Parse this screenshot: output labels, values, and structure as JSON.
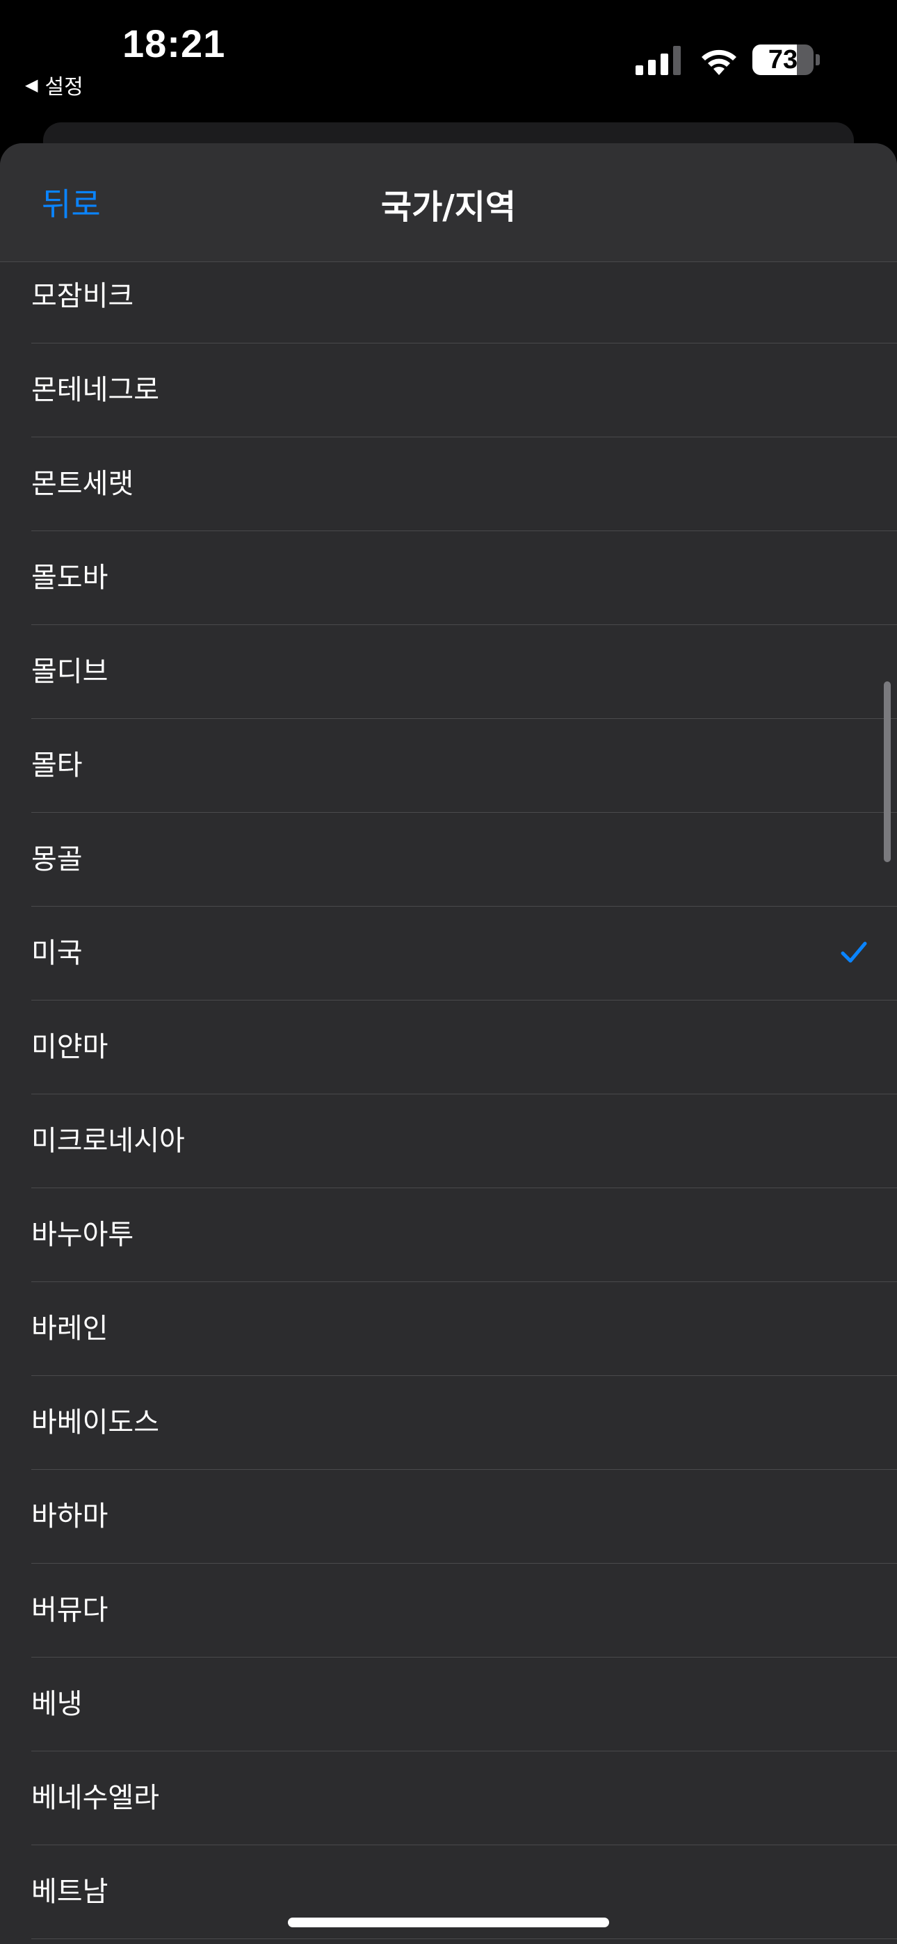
{
  "status": {
    "time": "18:21",
    "back_app_label": "설정",
    "battery_level": "73"
  },
  "nav": {
    "back_label": "뒤로",
    "title": "국가/지역"
  },
  "list": {
    "items": [
      {
        "label": "모잠비크",
        "selected": false
      },
      {
        "label": "몬테네그로",
        "selected": false
      },
      {
        "label": "몬트세랫",
        "selected": false
      },
      {
        "label": "몰도바",
        "selected": false
      },
      {
        "label": "몰디브",
        "selected": false
      },
      {
        "label": "몰타",
        "selected": false
      },
      {
        "label": "몽골",
        "selected": false
      },
      {
        "label": "미국",
        "selected": true
      },
      {
        "label": "미얀마",
        "selected": false
      },
      {
        "label": "미크로네시아",
        "selected": false
      },
      {
        "label": "바누아투",
        "selected": false
      },
      {
        "label": "바레인",
        "selected": false
      },
      {
        "label": "바베이도스",
        "selected": false
      },
      {
        "label": "바하마",
        "selected": false
      },
      {
        "label": "버뮤다",
        "selected": false
      },
      {
        "label": "베냉",
        "selected": false
      },
      {
        "label": "베네수엘라",
        "selected": false
      },
      {
        "label": "베트남",
        "selected": false
      }
    ]
  },
  "colors": {
    "accent": "#0a84ff",
    "sheet_background": "#2c2c2e",
    "nav_background": "#313133"
  }
}
